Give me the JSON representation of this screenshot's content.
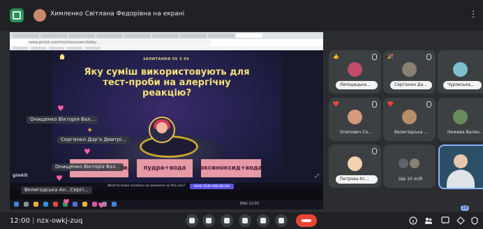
{
  "presenter": {
    "title": "Химленко Світлана Федорівна на екрані",
    "more_icon": "more-vert-icon"
  },
  "browser": {
    "url": "www.gimkit.com/host/classroom/lobby"
  },
  "game": {
    "question_counter": "ЗАПИТАННЯ 05 З 05",
    "question": "Яку суміш використовують для тест-проби на алергічну реакцію?",
    "answers": [
      "пудра+оксиноксид",
      "пудра+вода",
      "оксиноксид+вода"
    ],
    "brand": "gimkit",
    "cta_text": "Want to make creations as awesome as this one?",
    "cta_button": "MAKE YOUR OWN BELOW"
  },
  "reactions": [
    "Онищенко Вікторія Вал...",
    "Сергієнко Дар’я Дмитрі...",
    "Онищенко Вікторія Вал...",
    "Велигодська Ан...Сергі..."
  ],
  "taskbar": {
    "tray_text": "ENG 12:00"
  },
  "participants": [
    {
      "name": "Лепіщецька...",
      "emoji": "👍",
      "avatar_color": "#c24b6a"
    },
    {
      "name": "Сергієнко Да...",
      "emoji": "🎉",
      "avatar_color": "#8a7f73"
    },
    {
      "name": "Чуріжська...",
      "emoji": "",
      "avatar_color": "#7bbfcf"
    },
    {
      "name": "Осипович Со...",
      "emoji": "❤️",
      "avatar_color": "#d69a7a"
    },
    {
      "name": "Велигодська ...",
      "emoji": "❤️",
      "avatar_color": "#b88d6a"
    },
    {
      "name": "Нежива Валян...",
      "emoji": "",
      "avatar_color": "#6b8a5c"
    },
    {
      "name": "Петрова Кс...",
      "emoji": "",
      "avatar_color": "#f2d0b0"
    },
    {
      "name": "Ще 10 осіб",
      "emoji": "",
      "avatar_color": "#5f6368"
    },
    {
      "name": "",
      "emoji": "",
      "avatar_color": "#2b4f66"
    }
  ],
  "bottom": {
    "time": "12:00",
    "meeting_code": "nzx-owkj-zuq",
    "participant_count": "19"
  }
}
